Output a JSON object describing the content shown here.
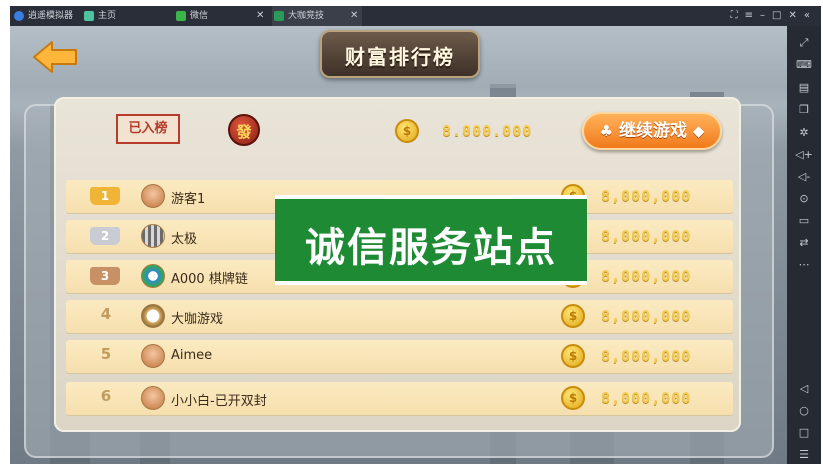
{
  "window": {
    "tabs": [
      {
        "label": "逍遥模拟器"
      },
      {
        "label": "主页"
      },
      {
        "label": "微信"
      },
      {
        "label": "大咖竞技"
      }
    ]
  },
  "game": {
    "title": "财富排行榜",
    "ranked_label": "已入榜",
    "badge_char": "發",
    "my_money": "8.000.000",
    "continue_label": "继续游戏",
    "coin_symbol": "$",
    "rows": [
      {
        "rank": "1",
        "name": "游客1",
        "money": "8,000,000"
      },
      {
        "rank": "2",
        "name": "太极",
        "money": "8,000,000"
      },
      {
        "rank": "3",
        "name": "A000 棋牌链",
        "money": "8,000,000"
      },
      {
        "rank": "4",
        "name": "大咖游戏",
        "money": "8,000,000"
      },
      {
        "rank": "5",
        "name": "Aimee",
        "money": "8,000,000"
      },
      {
        "rank": "6",
        "name": "小小白-已开双封",
        "money": "8,000,000"
      }
    ]
  },
  "watermark": {
    "text": "诚信服务站点"
  },
  "colors": {
    "accent": "#f17a1c",
    "money": "#f2ca54",
    "watermark": "#1e8a33"
  }
}
